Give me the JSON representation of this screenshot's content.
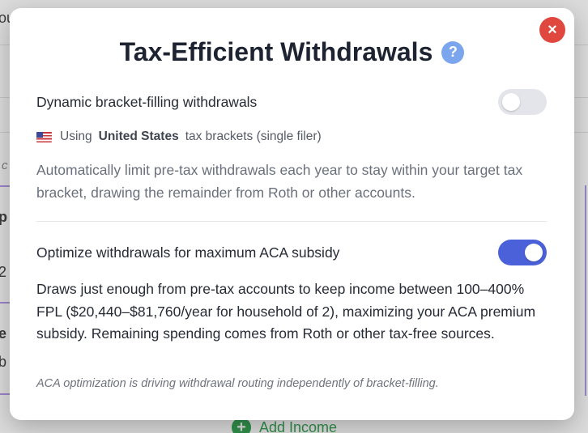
{
  "background": {
    "fragments": [
      "ou",
      "c",
      "p",
      "2",
      "e",
      "b"
    ],
    "add_income_label": "Add Income",
    "add_income_icon": "+"
  },
  "modal": {
    "title": "Tax-Efficient Withdrawals",
    "help_icon": "?",
    "close_icon": "×",
    "bracket_filling": {
      "label": "Dynamic bracket-filling withdrawals",
      "enabled": false,
      "using_prefix": "Using",
      "country": "United States",
      "using_suffix": "tax brackets (single filer)",
      "description": "Automatically limit pre-tax withdrawals each year to stay within your target tax bracket, drawing the remainder from Roth or other accounts."
    },
    "aca": {
      "label": "Optimize withdrawals for maximum ACA subsidy",
      "enabled": true,
      "description": "Draws just enough from pre-tax accounts to keep income between 100–400% FPL ($20,440–$81,760/year for household of 2), maximizing your ACA premium subsidy. Remaining spending comes from Roth or other tax-free sources.",
      "note": "ACA optimization is driving withdrawal routing independently of bracket-filling."
    }
  },
  "colors": {
    "toggle_on": "#4b61d9",
    "toggle_off": "#e3e5ea",
    "close_button": "#e0473e",
    "help_icon": "#7ba6ee",
    "add_income": "#2f8f4a"
  }
}
